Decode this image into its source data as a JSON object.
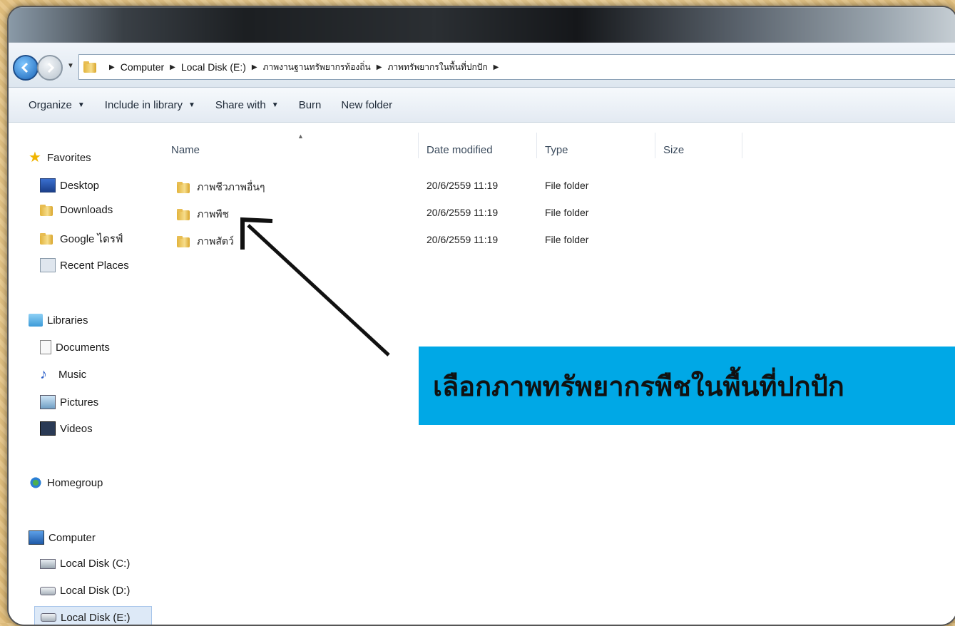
{
  "breadcrumb": [
    "Computer",
    "Local Disk (E:)",
    "ภาพงานฐานทรัพยากรท้องถิ่น",
    "ภาพทรัพยากรในพื้นที่ปกปัก"
  ],
  "toolbar": {
    "organize": "Organize",
    "include": "Include in library",
    "share": "Share with",
    "burn": "Burn",
    "new_folder": "New folder"
  },
  "nav": {
    "favorites": "Favorites",
    "desktop": "Desktop",
    "downloads": "Downloads",
    "google_drive": "Google ไดรฟ์",
    "recent": "Recent Places",
    "libraries": "Libraries",
    "documents": "Documents",
    "music": "Music",
    "pictures": "Pictures",
    "videos": "Videos",
    "homegroup": "Homegroup",
    "computer": "Computer",
    "disk_c": "Local Disk (C:)",
    "disk_d": "Local Disk (D:)",
    "disk_e": "Local Disk (E:)"
  },
  "columns": {
    "name": "Name",
    "date": "Date modified",
    "type": "Type",
    "size": "Size"
  },
  "files": [
    {
      "name": "ภาพชีวภาพอื่นๆ",
      "date": "20/6/2559 11:19",
      "type": "File folder"
    },
    {
      "name": "ภาพพืช",
      "date": "20/6/2559 11:19",
      "type": "File folder"
    },
    {
      "name": "ภาพสัตว์",
      "date": "20/6/2559 11:19",
      "type": "File folder"
    }
  ],
  "callout": "เลือกภาพทรัพยากรพืชในพื้นที่ปกปัก",
  "colors": {
    "callout_bg": "#00a8e6",
    "background": "#e9c98a"
  }
}
